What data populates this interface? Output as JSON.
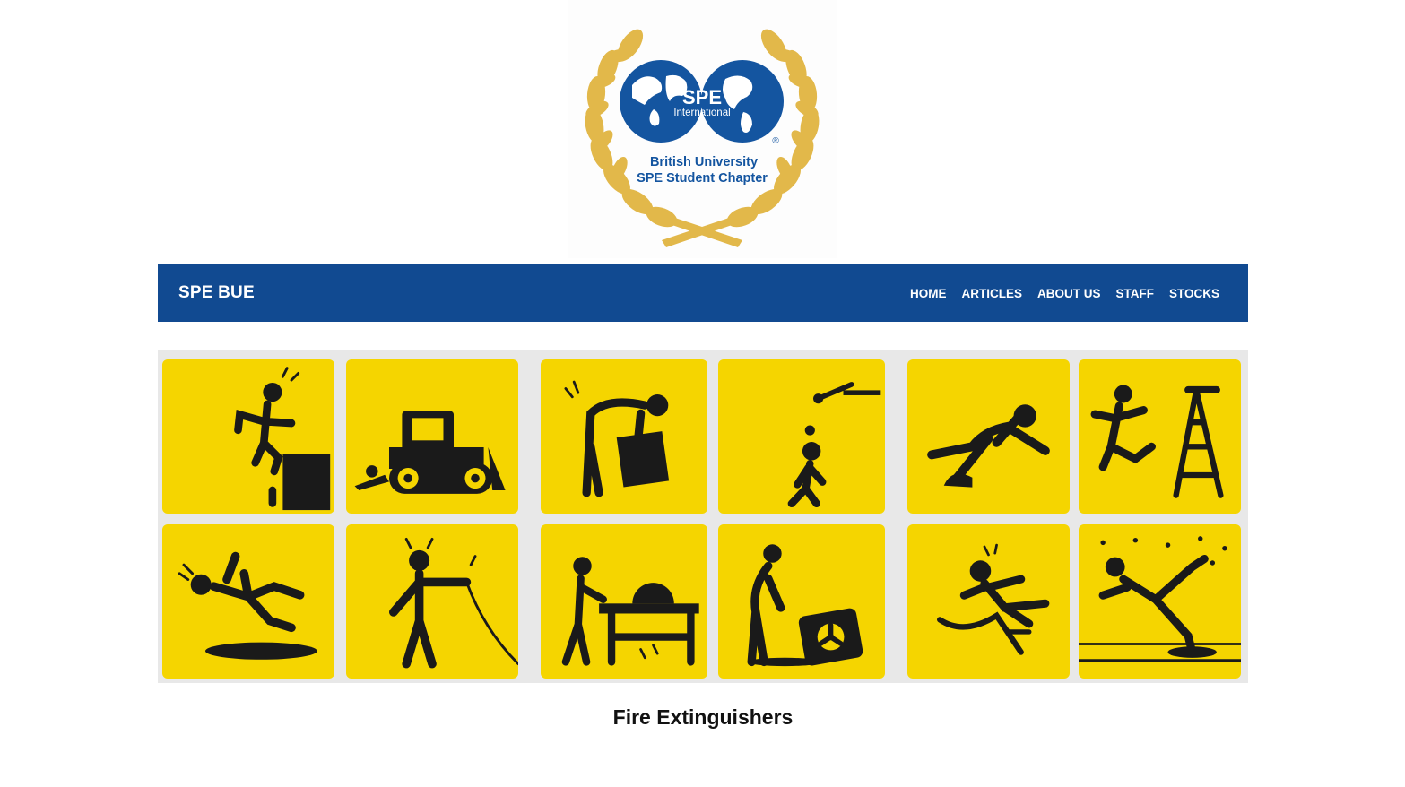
{
  "logo": {
    "brand_text": "SPE",
    "sub_text": "International",
    "registered_mark": "®",
    "line1": "British University",
    "line2": "SPE Student Chapter"
  },
  "nav": {
    "brand": "SPE BUE",
    "links": [
      "HOME",
      "ARTICLES",
      "ABOUT US",
      "STAFF",
      "STOCKS"
    ]
  },
  "hero": {
    "tile_color": "#f5d500",
    "figure_color": "#1a1a1a",
    "icons": [
      "fall-from-height-icon",
      "bulldozer-hazard-icon",
      "lifting-strain-icon",
      "falling-object-icon",
      "trip-hazard-icon",
      "ladder-fall-icon",
      "slip-puddle-icon",
      "electric-shock-icon",
      "saw-injury-icon",
      "radiation-hazard-icon",
      "hose-trip-icon",
      "floor-opening-fall-icon"
    ]
  },
  "content": {
    "title": "Fire Extinguishers"
  },
  "colors": {
    "navbar": "#114a91",
    "gold": "#e2b84a",
    "globe": "#1455a0"
  }
}
